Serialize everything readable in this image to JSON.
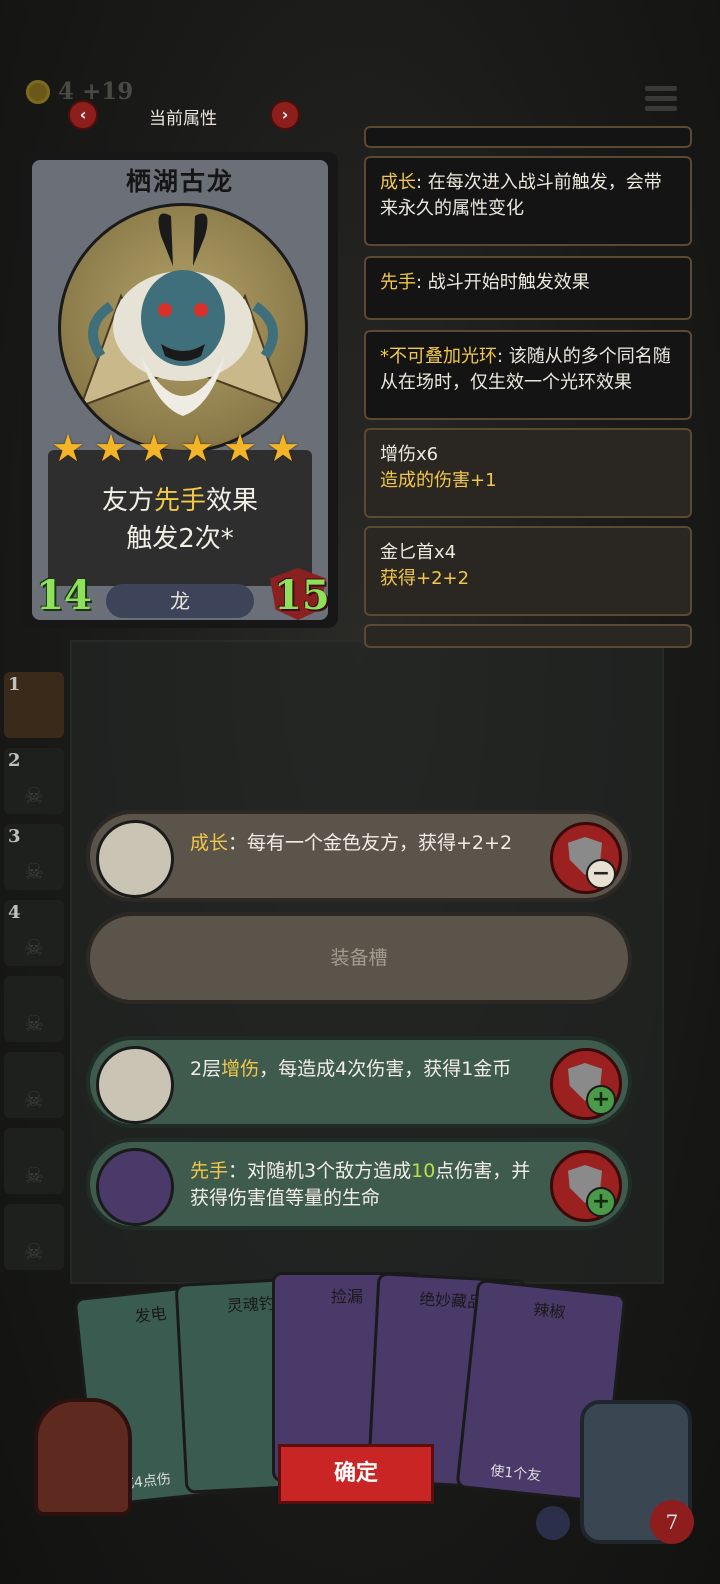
{
  "topbar": {
    "gold_text": "4 +19",
    "panel_title": "当前属性",
    "prev_icon": "‹",
    "next_icon": "›"
  },
  "hero_card": {
    "name": "栖湖古龙",
    "stars": 6,
    "text_line1_pre": "友方",
    "text_line1_kw": "先手",
    "text_line1_post": "效果",
    "text_line2": "触发2次*",
    "tribe": "龙",
    "attack": "14",
    "health": "15"
  },
  "info_panels": [
    {
      "keyword": "成长",
      "text": ": 在每次进入战斗前触发，会带来永久的属性变化"
    },
    {
      "keyword": "先手",
      "text": ": 战斗开始时触发效果"
    },
    {
      "keyword": "*不可叠加光环",
      "text": ": 该随从的多个同名随从在场时，仅生效一个光环效果"
    },
    {
      "title": "增伤x6",
      "sub": "造成的伤害+1"
    },
    {
      "title": "金匕首x4",
      "sub": "获得+2+2"
    }
  ],
  "roster": [
    "1",
    "2",
    "3",
    "4",
    "",
    "",
    "",
    ""
  ],
  "slots": {
    "slot1": {
      "kw": "成长",
      "text": "：每有一个金色友方，获得+2+2",
      "button": "−"
    },
    "empty": {
      "label": "装备槽"
    },
    "slot2": {
      "pre": "2层",
      "kw": "增伤",
      "text": "，每造成4次伤害，获得1金币",
      "button": "+"
    },
    "slot3": {
      "kw": "先手",
      "text_a": "：对随机3个敌方造成",
      "num": "10",
      "text_b": "点伤害，并获得伤害值等量的生命",
      "button": "+"
    }
  },
  "hand": {
    "cards": [
      "发电",
      "灵魂钓",
      "捡漏",
      "绝妙藏品",
      "辣椒"
    ],
    "card1_desc": "造成4点伤",
    "card5_desc": "使1个友"
  },
  "confirm_label": "确定",
  "hero_hp": "7",
  "colors": {
    "accent_gold": "#f1c84a",
    "confirm_red": "#c92525",
    "stat_green": "#8fe05a"
  }
}
